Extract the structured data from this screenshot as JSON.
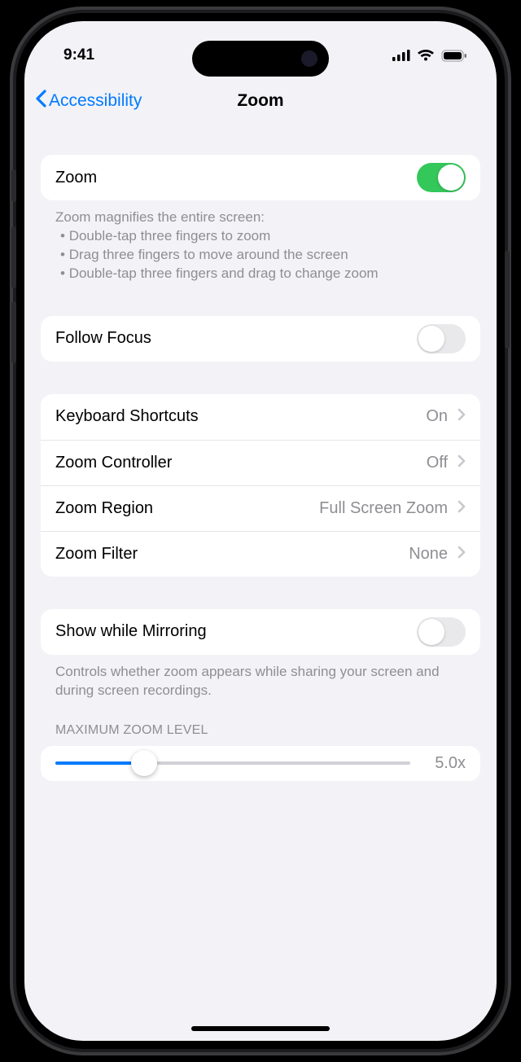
{
  "status": {
    "time": "9:41"
  },
  "nav": {
    "back": "Accessibility",
    "title": "Zoom"
  },
  "zoom": {
    "row_label": "Zoom",
    "enabled": true,
    "footer_lead": "Zoom magnifies the entire screen:",
    "footer_bullets": [
      "Double-tap three fingers to zoom",
      "Drag three fingers to move around the screen",
      "Double-tap three fingers and drag to change zoom"
    ]
  },
  "follow_focus": {
    "label": "Follow Focus",
    "enabled": false
  },
  "opts": {
    "keyboard_shortcuts": {
      "label": "Keyboard Shortcuts",
      "value": "On"
    },
    "zoom_controller": {
      "label": "Zoom Controller",
      "value": "Off"
    },
    "zoom_region": {
      "label": "Zoom Region",
      "value": "Full Screen Zoom"
    },
    "zoom_filter": {
      "label": "Zoom Filter",
      "value": "None"
    }
  },
  "mirroring": {
    "label": "Show while Mirroring",
    "enabled": false,
    "footer": "Controls whether zoom appears while sharing your screen and during screen recordings."
  },
  "max_zoom": {
    "header": "MAXIMUM ZOOM LEVEL",
    "value_text": "5.0x",
    "fraction": 0.25
  }
}
